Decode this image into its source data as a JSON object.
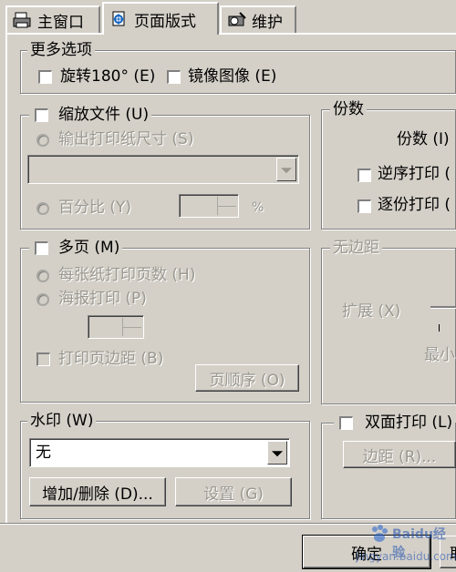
{
  "tabs": [
    {
      "label": "主窗口",
      "icon": "printer-icon"
    },
    {
      "label": "页面版式",
      "icon": "page-layout-icon"
    },
    {
      "label": "维护",
      "icon": "maintenance-icon"
    }
  ],
  "more_options": {
    "title": "更多选项",
    "rotate": "旋转180° (E)",
    "mirror": "镜像图像 (E)"
  },
  "scale": {
    "title": "缩放文件 (U)",
    "output_paper": "输出打印纸尺寸 (S)",
    "percent": "百分比 (Y)",
    "percent_unit": "%"
  },
  "copies": {
    "title": "份数",
    "copies_label": "份数 (I)",
    "reverse": "逆序打印 (",
    "collate": "逐份打印 ("
  },
  "multipage": {
    "title": "多页 (M)",
    "pages_per_sheet": "每张纸打印页数 (H)",
    "poster": "海报打印 (P)",
    "print_border": "打印页边距 (B)",
    "page_order": "页顺序 (O)"
  },
  "borderless": {
    "title": "无边距",
    "expand": "扩展 (X)",
    "min": "最小"
  },
  "watermark": {
    "title": "水印 (W)",
    "selected": "无",
    "add_delete": "增加/删除 (D)...",
    "settings": "设置 (G)"
  },
  "duplex": {
    "title": "双面打印 (L)",
    "margin": "边距 (R)..."
  },
  "footer": {
    "ok": "确定",
    "cancel": "取"
  },
  "watermark_text": "Baidu经验",
  "watermark_url": "jingyan.baidu.com"
}
